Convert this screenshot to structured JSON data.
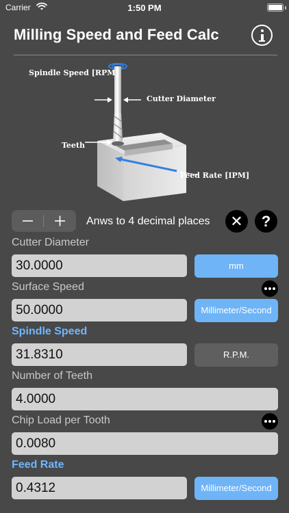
{
  "status_bar": {
    "carrier": "Carrier",
    "time": "1:50 PM"
  },
  "header": {
    "title": "Milling Speed and Feed Calc",
    "info_icon": "info-icon"
  },
  "diagram": {
    "labels": {
      "spindle_speed": "Spindle Speed [RPM]",
      "cutter_diameter": "Cutter Diameter",
      "teeth": "Teeth",
      "feed_rate": "Feed Rate [IPM]"
    },
    "accent": "#2f7fe0"
  },
  "controls": {
    "minus_label": "−",
    "plus_label": "+",
    "decimals_text": "Anws to 4 decimal places",
    "clear_label": "✕",
    "help_label": "?"
  },
  "fields": {
    "cutter_diameter": {
      "label": "Cutter Diameter",
      "value": "30.0000",
      "unit": "mm"
    },
    "surface_speed": {
      "label": "Surface Speed",
      "value": "50.0000",
      "unit": "Millimeter/Second"
    },
    "spindle_speed": {
      "label": "Spindle Speed",
      "value": "31.8310",
      "unit": "R.P.M."
    },
    "number_of_teeth": {
      "label": "Number of Teeth",
      "value": "4.0000"
    },
    "chip_load": {
      "label": "Chip Load per Tooth",
      "value": "0.0080"
    },
    "feed_rate": {
      "label": "Feed Rate",
      "value": "0.4312",
      "unit": "Millimeter/Second"
    }
  },
  "colors": {
    "background": "#484848",
    "accent_blue": "#6eb4f7",
    "active_label": "#6fb6ff"
  }
}
